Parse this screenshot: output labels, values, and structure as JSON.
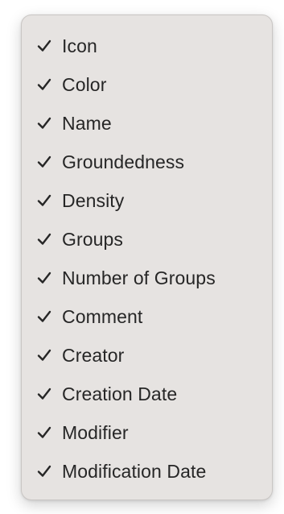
{
  "menu": {
    "items": [
      {
        "label": "Icon",
        "checked": true
      },
      {
        "label": "Color",
        "checked": true
      },
      {
        "label": "Name",
        "checked": true
      },
      {
        "label": "Groundedness",
        "checked": true
      },
      {
        "label": "Density",
        "checked": true
      },
      {
        "label": "Groups",
        "checked": true
      },
      {
        "label": "Number of Groups",
        "checked": true
      },
      {
        "label": "Comment",
        "checked": true
      },
      {
        "label": "Creator",
        "checked": true
      },
      {
        "label": "Creation Date",
        "checked": true
      },
      {
        "label": "Modifier",
        "checked": true
      },
      {
        "label": "Modification Date",
        "checked": true
      }
    ],
    "check_icon": "checkmark-icon"
  },
  "colors": {
    "menu_background": "#e6e3e1",
    "text": "#262626"
  }
}
